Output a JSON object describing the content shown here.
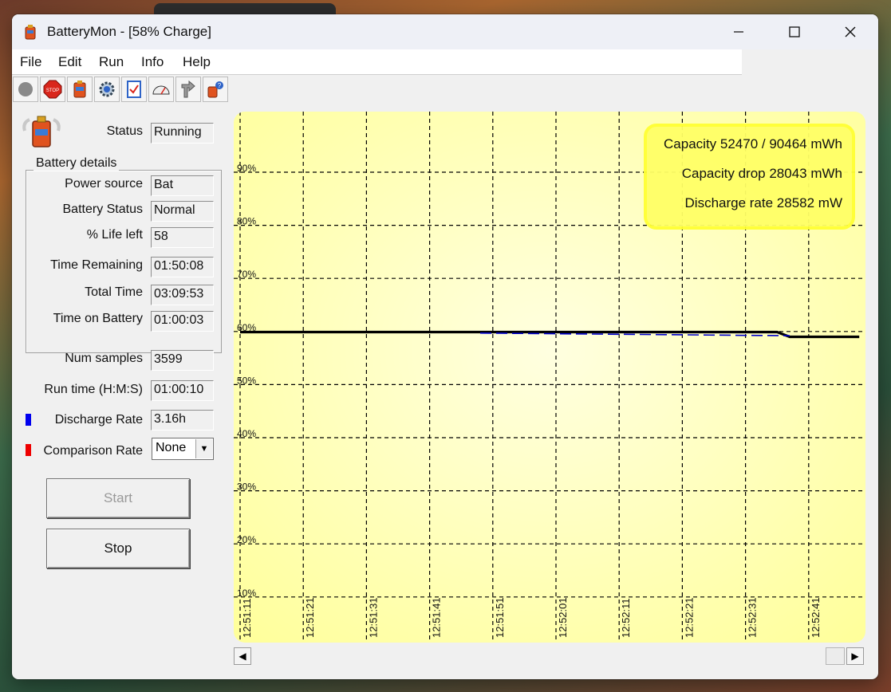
{
  "window": {
    "title": "BatteryMon - [58% Charge]",
    "controls": [
      "minimize",
      "maximize",
      "close"
    ]
  },
  "menu": [
    "File",
    "Edit",
    "Run",
    "Info",
    "Help"
  ],
  "toolbar": [
    {
      "name": "record-icon"
    },
    {
      "name": "stop-icon",
      "text": "STOP"
    },
    {
      "name": "battery-icon"
    },
    {
      "name": "settings-icon"
    },
    {
      "name": "checklist-icon"
    },
    {
      "name": "gauge-icon"
    },
    {
      "name": "pointer-icon"
    },
    {
      "name": "help-icon"
    }
  ],
  "status": {
    "label": "Status",
    "value": "Running"
  },
  "battery_details": {
    "title": "Battery details",
    "rows": [
      {
        "label": "Power source",
        "value": "Bat"
      },
      {
        "label": "Battery Status",
        "value": "Normal"
      },
      {
        "label": "% Life left",
        "value": "58"
      },
      {
        "label": "Time Remaining",
        "value": "01:50:08"
      },
      {
        "label": "Total Time",
        "value": "03:09:53"
      },
      {
        "label": "Time on Battery",
        "value": "01:00:03"
      }
    ]
  },
  "num_samples": {
    "label": "Num samples",
    "value": "3599"
  },
  "run_time": {
    "label": "Run time (H:M:S)",
    "value": "01:00:10"
  },
  "discharge_rate": {
    "label": "Discharge Rate",
    "value": "3.16h",
    "color": "#0000ee"
  },
  "comparison_rate": {
    "label": "Comparison Rate",
    "value": "None",
    "color": "#ee0000"
  },
  "buttons": {
    "start": "Start",
    "stop": "Stop"
  },
  "chart_data": {
    "type": "line",
    "ylim": [
      10,
      95
    ],
    "y_ticks": [
      "90%",
      "80%",
      "70%",
      "60%",
      "50%",
      "40%",
      "30%",
      "20%",
      "10%"
    ],
    "x_ticks": [
      "12:51:11",
      "12:51:21",
      "12:51:31",
      "12:51:41",
      "12:51:51",
      "12:52:01",
      "12:52:11",
      "12:52:21",
      "12:52:31",
      "12:52:41"
    ],
    "grid": true,
    "background_color": "#ffff99",
    "series": [
      {
        "style": "solid",
        "color": "#000000",
        "points": [
          [
            "12:51:11",
            59.9
          ],
          [
            "12:52:36",
            59.9
          ],
          [
            "12:52:38",
            59.0
          ],
          [
            "12:52:49",
            59.0
          ]
        ]
      },
      {
        "style": "dashed",
        "color": "#0000cc",
        "points": [
          [
            "12:51:49",
            59.7
          ],
          [
            "12:52:38",
            59.2
          ]
        ]
      }
    ],
    "info_box": [
      "Capacity 52470 / 90464 mWh",
      "Capacity drop 28043 mWh",
      "Discharge rate 28582 mW"
    ]
  }
}
